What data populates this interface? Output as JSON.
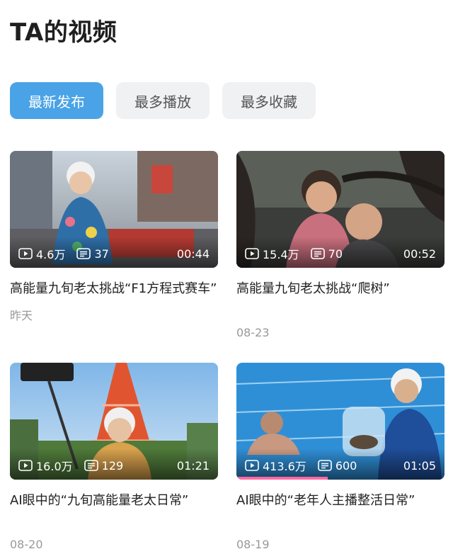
{
  "header": {
    "title": "TA的视频"
  },
  "tabs": [
    {
      "label": "最新发布",
      "active": true
    },
    {
      "label": "最多播放",
      "active": false
    },
    {
      "label": "最多收藏",
      "active": false
    }
  ],
  "videos": [
    {
      "plays": "4.6万",
      "comments": "37",
      "duration": "00:44",
      "title": "高能量九旬老太挑战“F1方程式赛车”",
      "date": "昨天",
      "watched_fraction": 0
    },
    {
      "plays": "15.4万",
      "comments": "70",
      "duration": "00:52",
      "title": "高能量九旬老太挑战“爬树”",
      "date": "08-23",
      "watched_fraction": 0
    },
    {
      "plays": "16.0万",
      "comments": "129",
      "duration": "01:21",
      "title": "AI眼中的“九旬高能量老太日常”",
      "date": "08-20",
      "watched_fraction": 0
    },
    {
      "plays": "413.6万",
      "comments": "600",
      "duration": "01:05",
      "title": "AI眼中的“老年人主播整活日常”",
      "date": "08-19",
      "watched_fraction": 0.44
    }
  ],
  "icons": {
    "plays": "play-icon",
    "comments": "comment-icon"
  },
  "colors": {
    "accent": "#4aa3e6",
    "progress": "#ff6aa2"
  }
}
